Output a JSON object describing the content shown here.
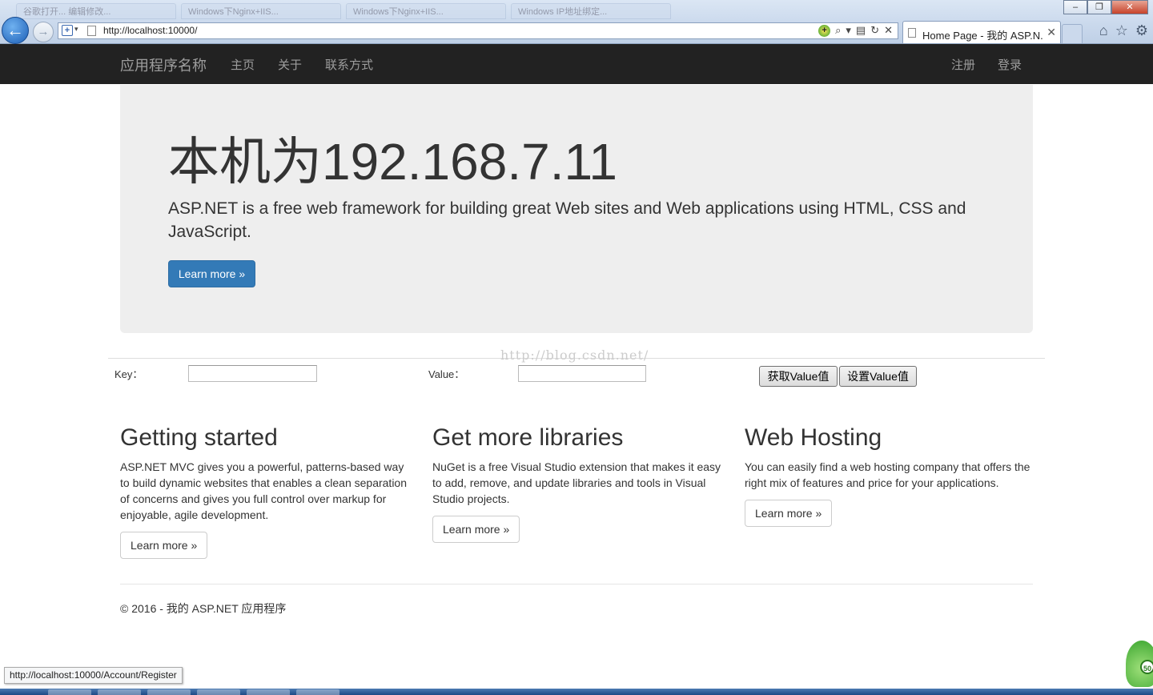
{
  "browser": {
    "background_tabs": [
      "谷歌打开... 编辑修改...",
      "Windows下Nginx+IIS...",
      "Windows下Nginx+IIS...",
      "Windows IP地址绑定..."
    ],
    "url": "http://localhost:10000/",
    "active_tab_title": "Home Page - 我的 ASP.N...",
    "status_url": "http://localhost:10000/Account/Register"
  },
  "navbar": {
    "brand": "应用程序名称",
    "links": [
      "主页",
      "关于",
      "联系方式"
    ],
    "right_links": [
      "注册",
      "登录"
    ]
  },
  "jumbotron": {
    "heading": "本机为192.168.7.11",
    "lead": "ASP.NET is a free web framework for building great Web sites and Web applications using HTML, CSS and JavaScript.",
    "button": "Learn more »"
  },
  "watermark": "http://blog.csdn.net/",
  "form": {
    "key_label": "Key：",
    "key_value": "",
    "value_label": "Value：",
    "value_value": "",
    "get_button": "获取Value值",
    "set_button": "设置Value值"
  },
  "columns": [
    {
      "title": "Getting started",
      "text": "ASP.NET MVC gives you a powerful, patterns-based way to build dynamic websites that enables a clean separation of concerns and gives you full control over markup for enjoyable, agile development.",
      "button": "Learn more »"
    },
    {
      "title": "Get more libraries",
      "text": "NuGet is a free Visual Studio extension that makes it easy to add, remove, and update libraries and tools in Visual Studio projects.",
      "button": "Learn more »"
    },
    {
      "title": "Web Hosting",
      "text": "You can easily find a web hosting company that offers the right mix of features and price for your applications.",
      "button": "Learn more »"
    }
  ],
  "footer": "© 2016 - 我的 ASP.NET 应用程序",
  "badge_count": "50",
  "colors": {
    "navbar_bg": "#222222",
    "navbar_text": "#9d9d9d",
    "jumbotron_bg": "#eeeeee",
    "primary": "#337ab7"
  }
}
